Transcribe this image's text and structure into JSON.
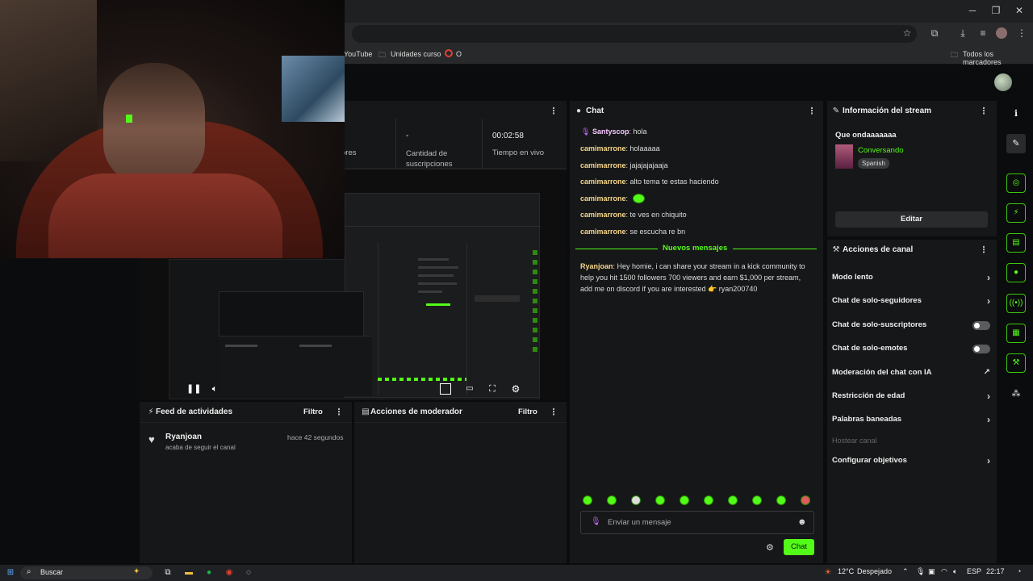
{
  "browser": {
    "window_controls": {
      "minimize": "─",
      "restore": "❐",
      "close": "✕"
    },
    "bookmarks": [
      {
        "label": "YouTube",
        "icon": "folder-icon"
      },
      {
        "label": "Unidades curso",
        "icon": "folder-icon"
      },
      {
        "label": "O",
        "icon": "google-icon"
      }
    ],
    "all_bookmarks": "Todos los marcadores"
  },
  "stats": {
    "followers_label": "ores",
    "subs_value": "-",
    "subs_label": "Cantidad de suscripciones",
    "live_value": "00:02:58",
    "live_label": "Tiempo en vivo"
  },
  "chat": {
    "title": "Chat",
    "messages": [
      {
        "user": "Santyscop",
        "text": "hola"
      },
      {
        "user": "camimarrone",
        "text": "holaaaaa"
      },
      {
        "user": "camimarrone",
        "text": "jajajajajaaja"
      },
      {
        "user": "camimarrone",
        "text": "alto tema te estas haciendo"
      },
      {
        "user": "camimarrone",
        "text": ""
      },
      {
        "user": "camimarrone",
        "text": "te ves en chiquito"
      },
      {
        "user": "camimarrone",
        "text": "se escucha re bn"
      }
    ],
    "new_messages": "Nuevos mensajes",
    "new_msg_user": "Ryanjoan",
    "new_msg_lines": [
      "Hey homie, i can share your stream in a kick community to",
      "help you hit 1500 followers 700 viewers and earn $1,000 per stream,",
      "add me on discord if you are interested 👉  ryan200740"
    ],
    "input_placeholder": "Enviar un mensaje",
    "send_label": "Chat"
  },
  "stream_info": {
    "title": "Información del stream",
    "stream_title": "Que ondaaaaaaa",
    "category": "Conversando",
    "language": "Spanish",
    "edit_label": "Editar"
  },
  "channel_actions": {
    "title": "Acciones de canal",
    "items": [
      {
        "label": "Modo lento",
        "control": "chevron"
      },
      {
        "label": "Chat de solo-seguidores",
        "control": "chevron"
      },
      {
        "label": "Chat de solo-suscriptores",
        "control": "toggle"
      },
      {
        "label": "Chat de solo-emotes",
        "control": "toggle"
      },
      {
        "label": "Moderación del chat con IA",
        "control": "external"
      },
      {
        "label": "Restricción de edad",
        "control": "chevron"
      },
      {
        "label": "Palabras baneadas",
        "control": "chevron"
      },
      {
        "label": "Hostear canal",
        "control": "none"
      },
      {
        "label": "Configurar objetivos",
        "control": "chevron"
      }
    ]
  },
  "activity_feed": {
    "title": "Feed de actividades",
    "filter": "Filtro",
    "user": "Ryanjoan",
    "action": "acaba de seguir el canal",
    "time": "hace 42 segundos"
  },
  "mod_actions": {
    "title": "Acciones de moderador",
    "filter": "Filtro"
  },
  "taskbar": {
    "search": "Buscar",
    "weather": "12°C",
    "weather_desc": "Despejado",
    "lang": "ESP",
    "time": "22:17"
  },
  "colors": {
    "accent": "#53fc18",
    "panel": "#161718",
    "bg": "#0b0c0d"
  }
}
